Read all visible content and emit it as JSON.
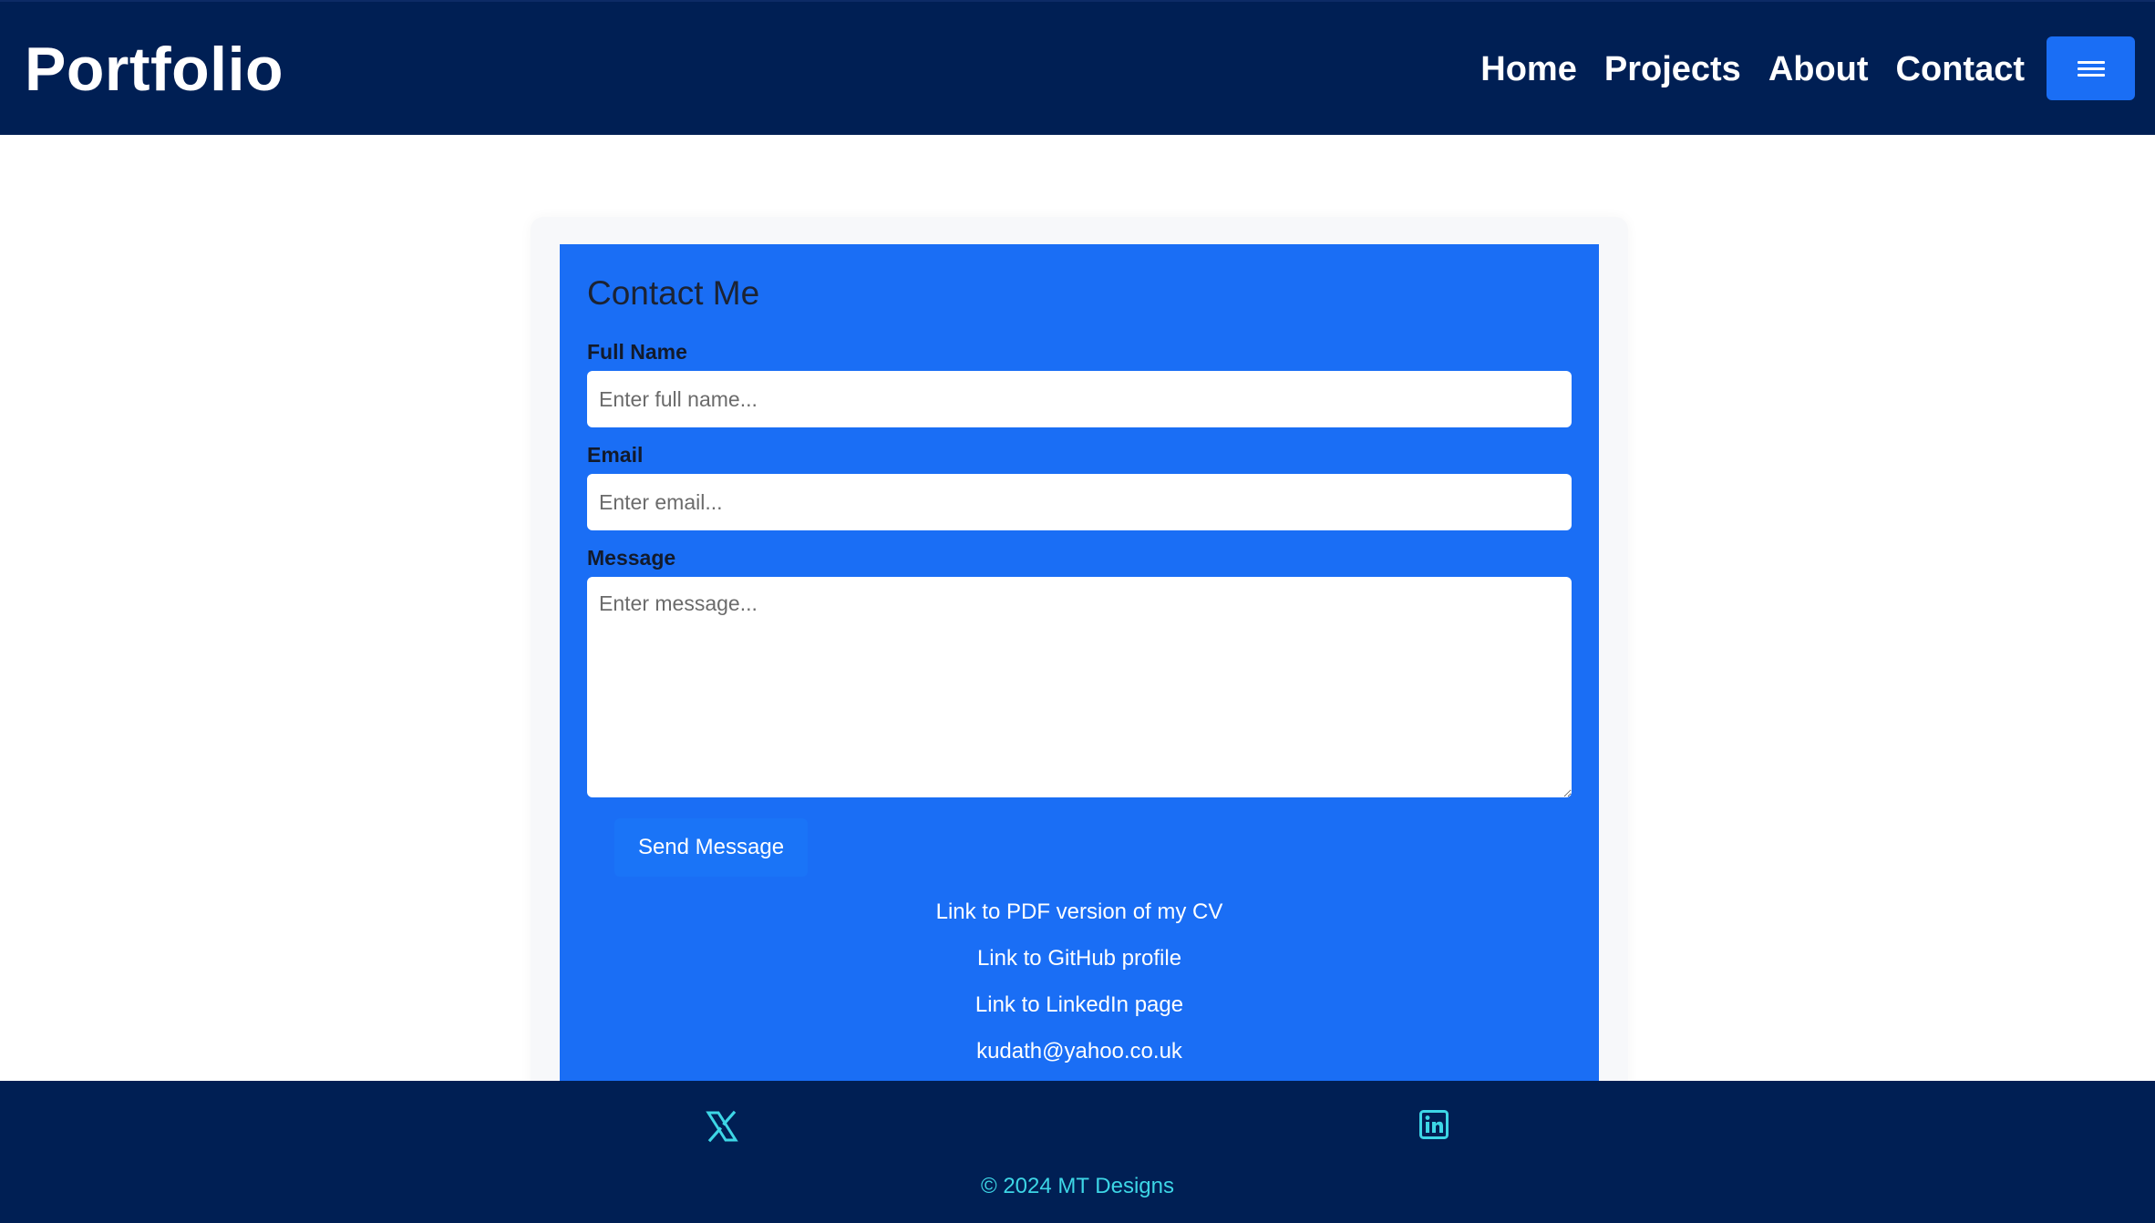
{
  "navbar": {
    "brand": "Portfolio",
    "links": [
      "Home",
      "Projects",
      "About",
      "Contact"
    ],
    "menu_icon": "hamburger-menu-icon",
    "background": "#001f54"
  },
  "contact": {
    "title": "Contact Me",
    "fields": {
      "full_name": {
        "label": "Full Name",
        "placeholder": "Enter full name..."
      },
      "email": {
        "label": "Email",
        "placeholder": "Enter email..."
      },
      "message": {
        "label": "Message",
        "placeholder": "Enter message..."
      }
    },
    "send_label": "Send Message",
    "links": [
      "Link to PDF version of my CV",
      "Link to GitHub profile",
      "Link to LinkedIn page",
      "kudath@yahoo.co.uk"
    ],
    "panel_color": "#1a6ef5"
  },
  "footer": {
    "icons": [
      "x-twitter-icon",
      "linkedin-icon"
    ],
    "copyright": "© 2024 MT Designs",
    "accent": "#3dd6e6"
  }
}
